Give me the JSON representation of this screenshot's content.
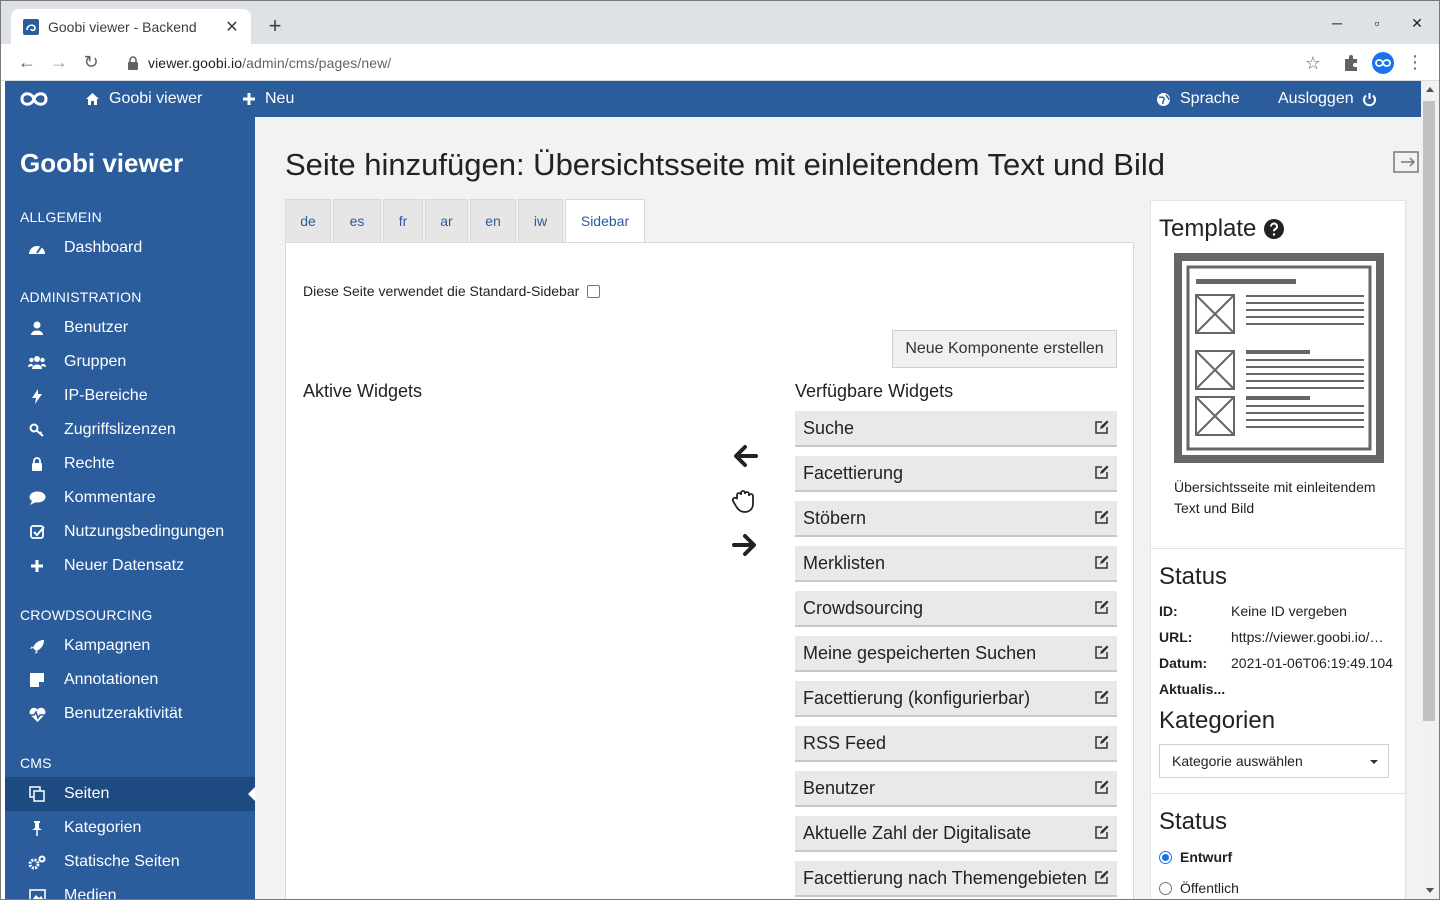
{
  "browser": {
    "tab_title": "Goobi viewer - Backend",
    "url_host": "viewer.goobi.io",
    "url_path": "/admin/cms/pages/new/"
  },
  "topnav": {
    "brand": "Goobi viewer",
    "new_label": "Neu",
    "language_label": "Sprache",
    "logout_label": "Ausloggen"
  },
  "sidebar": {
    "brand": "Goobi viewer",
    "sections": {
      "general": "ALLGEMEIN",
      "administration": "ADMINISTRATION",
      "crowdsourcing": "CROWDSOURCING",
      "cms": "CMS"
    },
    "items": {
      "dashboard": "Dashboard",
      "users": "Benutzer",
      "groups": "Gruppen",
      "ip_ranges": "IP-Bereiche",
      "licenses": "Zugriffslizenzen",
      "rights": "Rechte",
      "comments": "Kommentare",
      "terms": "Nutzungsbedingungen",
      "new_record": "Neuer Datensatz",
      "campaigns": "Kampagnen",
      "annotations": "Annotationen",
      "user_activity": "Benutzeraktivität",
      "pages": "Seiten",
      "categories": "Kategorien",
      "static_pages": "Statische Seiten",
      "media": "Medien"
    }
  },
  "main": {
    "title": "Seite hinzufügen: Übersichtsseite mit einleitendem Text und Bild",
    "tabs": [
      "de",
      "es",
      "fr",
      "ar",
      "en",
      "iw",
      "Sidebar"
    ],
    "active_tab": "Sidebar",
    "std_sidebar_label": "Diese Seite verwendet die Standard-Sidebar",
    "std_sidebar_checked": false,
    "new_component_button": "Neue Komponente erstellen",
    "active_widgets_heading": "Aktive Widgets",
    "available_widgets_heading": "Verfügbare Widgets",
    "available_widgets": [
      "Suche",
      "Facettierung",
      "Stöbern",
      "Merklisten",
      "Crowdsourcing",
      "Meine gespeicherten Suchen",
      "Facettierung (konfigurierbar)",
      "RSS Feed",
      "Benutzer",
      "Aktuelle Zahl der Digitalisate",
      "Facettierung nach Themengebieten"
    ]
  },
  "right_panel": {
    "template_heading": "Template",
    "template_description": "Übersichtsseite mit einleitendem Text und Bild",
    "status_heading": "Status",
    "id_label": "ID:",
    "id_value": "Keine ID vergeben",
    "url_label": "URL:",
    "url_value": "https://viewer.goobi.io/cms/",
    "date_label": "Datum:",
    "date_value": "2021-01-06T06:19:49.104",
    "updated_label": "Aktualis...",
    "categories_heading": "Kategorien",
    "categories_select": "Kategorie auswählen",
    "status2_heading": "Status",
    "radio_draft": "Entwurf",
    "radio_public": "Öffentlich",
    "selected_status": "Entwurf"
  },
  "colors": {
    "brand_blue": "#2b5c9c",
    "active_nav": "#1e4a82",
    "link_blue": "#2b5c9c"
  }
}
